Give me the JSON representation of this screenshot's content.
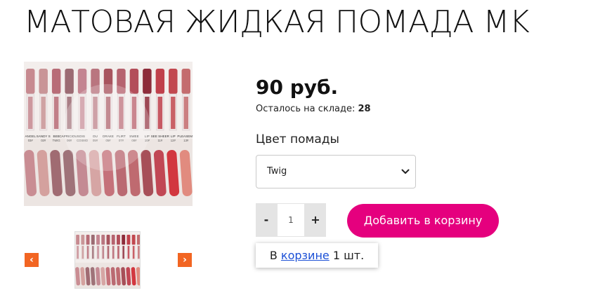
{
  "product": {
    "title": "МАТОВАЯ ЖИДКАЯ ПОМАДА MK",
    "price": "90 руб.",
    "stock_label": "Осталось на складе:",
    "stock_count": "28",
    "option_label": "Цвет помады",
    "selected_color": "Twig"
  },
  "gallery": {
    "swatch_labels": [
      "ANGEL",
      "SANDY S",
      "BEE",
      "CAPRICIOUS",
      "DIS",
      "DU",
      "DRAKE",
      "FLIRT",
      "SWEE",
      "LIP",
      "SEE SHEER",
      "LIP",
      "PLEASEME"
    ],
    "swatch_codes": [
      "03#",
      "02#",
      "TWIG",
      "06#",
      "COSMO",
      "05#",
      "05#",
      "07#",
      "08#",
      "10#",
      "11#",
      "12#",
      "13#"
    ],
    "tube_colors": [
      "#c78a90",
      "#c99597",
      "#b86c77",
      "#9c6b73",
      "#c48591",
      "#b9757f",
      "#a8545e",
      "#b6636f",
      "#b34e5a",
      "#8e2c3a",
      "#c0404b",
      "#c2484f",
      "#c46c6e"
    ],
    "swatch_colors": [
      "#c98d93",
      "#d4a19e",
      "#a06b72",
      "#9f7379",
      "#c48a93",
      "#d6a5a4",
      "#c5727a",
      "#ba6a72",
      "#bf6a70",
      "#a74f58",
      "#c14754",
      "#d2373f",
      "#e18b7f"
    ]
  },
  "quantity": {
    "minus": "-",
    "value": "1",
    "plus": "+"
  },
  "actions": {
    "add_to_cart": "Добавить в корзину"
  },
  "cart_notice": {
    "prefix": "В",
    "link": "корзине",
    "suffix": "1 шт."
  },
  "navigation": {
    "prev": "‹",
    "next": "›"
  },
  "colors": {
    "accent_pink": "#e5007e",
    "arrow_orange": "#f26522",
    "link_blue": "#1a4fd6"
  }
}
